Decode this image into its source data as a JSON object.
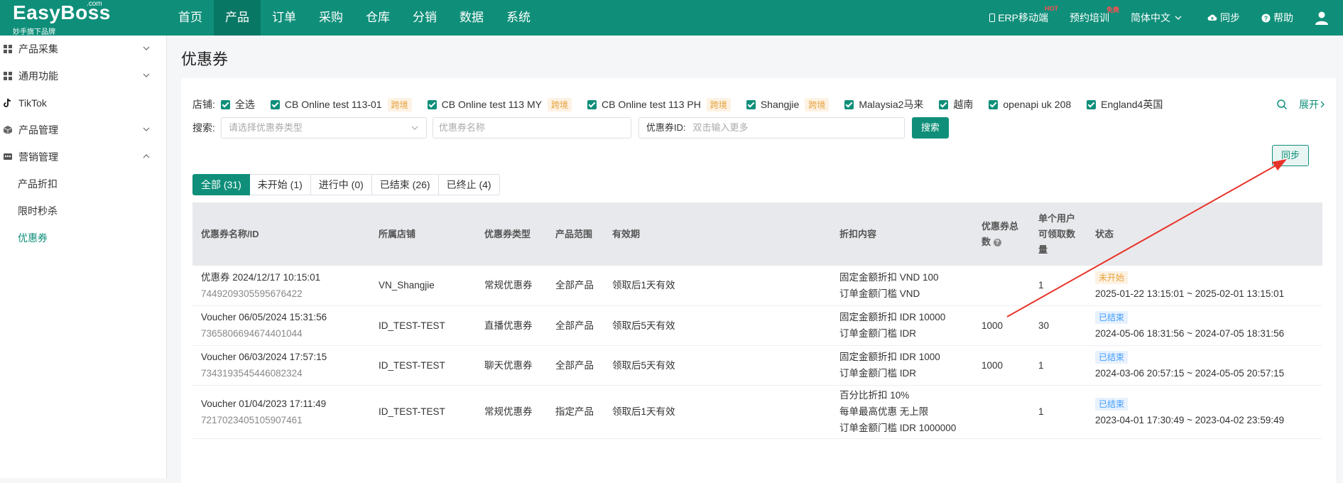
{
  "brand": {
    "name": "EasyBoss",
    "com": ".com",
    "slogan": "妙手旗下品牌"
  },
  "nav": [
    "首页",
    "产品",
    "订单",
    "采购",
    "仓库",
    "分销",
    "数据",
    "系统"
  ],
  "nav_active": 1,
  "top_right": {
    "erp": "ERP移动端",
    "erp_badge": "HOT",
    "training": "预约培训",
    "training_badge": "免费",
    "lang": "简体中文",
    "sync": "同步",
    "help": "帮助"
  },
  "sidebar": {
    "groups": [
      {
        "label": "产品采集",
        "expandable": true
      },
      {
        "label": "通用功能",
        "expandable": true
      },
      {
        "label": "TikTok",
        "expandable": false
      },
      {
        "label": "产品管理",
        "expandable": true
      },
      {
        "label": "营销管理",
        "expandable": true,
        "open": true
      }
    ],
    "subitems": [
      "产品折扣",
      "限时秒杀",
      "优惠券"
    ],
    "active_sub": 2
  },
  "page_title": "优惠券",
  "filters": {
    "store_label": "店铺:",
    "stores": [
      {
        "name": "全选",
        "tag": ""
      },
      {
        "name": "CB Online test 113-01",
        "tag": "跨境"
      },
      {
        "name": "CB Online test 113 MY",
        "tag": "跨境"
      },
      {
        "name": "CB Online test 113 PH",
        "tag": "跨境"
      },
      {
        "name": "Shangjie",
        "tag": "跨境"
      },
      {
        "name": "Malaysia2马来",
        "tag": ""
      },
      {
        "name": "越南",
        "tag": ""
      },
      {
        "name": "openapi uk 208",
        "tag": ""
      },
      {
        "name": "England4英国",
        "tag": ""
      }
    ],
    "expand_label": "展开",
    "search_label": "搜索:",
    "type_placeholder": "请选择优惠券类型",
    "name_placeholder": "优惠券名称",
    "id_label": "优惠券ID:",
    "id_placeholder": "双击输入更多",
    "search_button": "搜索"
  },
  "sync_button": "同步",
  "tabs": [
    "全部 (31)",
    "未开始 (1)",
    "进行中 (0)",
    "已结束 (26)",
    "已终止 (4)"
  ],
  "tab_active": 0,
  "table": {
    "headers": [
      "优惠券名称/ID",
      "所属店铺",
      "优惠券类型",
      "产品范围",
      "有效期",
      "折扣内容",
      "优惠券总数",
      "单个用户可领取数量",
      "状态"
    ],
    "rows": [
      {
        "name": "优惠券 2024/12/17 10:15:01",
        "id": "7449209305595676422",
        "store": "VN_Shangjie",
        "type": "常规优惠券",
        "scope": "全部产品",
        "validity": "领取后1天有效",
        "discount": [
          "固定金额折扣 VND 100",
          "订单金额门槛 VND"
        ],
        "total": "",
        "per_user": "1",
        "status": "未开始",
        "status_kind": "pending",
        "period": "2025-01-22 13:15:01 ~ 2025-02-01 13:15:01"
      },
      {
        "name": "Voucher 06/05/2024 15:31:56",
        "id": "7365806694674401044",
        "store": "ID_TEST-TEST",
        "type": "直播优惠券",
        "scope": "全部产品",
        "validity": "领取后5天有效",
        "discount": [
          "固定金额折扣 IDR 10000",
          "订单金额门槛 IDR"
        ],
        "total": "1000",
        "per_user": "30",
        "status": "已结束",
        "status_kind": "ended",
        "period": "2024-05-06 18:31:56 ~ 2024-07-05 18:31:56"
      },
      {
        "name": "Voucher 06/03/2024 17:57:15",
        "id": "7343193545446082324",
        "store": "ID_TEST-TEST",
        "type": "聊天优惠券",
        "scope": "全部产品",
        "validity": "领取后5天有效",
        "discount": [
          "固定金额折扣 IDR 1000",
          "订单金额门槛 IDR"
        ],
        "total": "1000",
        "per_user": "1",
        "status": "已结束",
        "status_kind": "ended",
        "period": "2024-03-06 20:57:15 ~ 2024-05-05 20:57:15"
      },
      {
        "name": "Voucher 01/04/2023 17:11:49",
        "id": "7217023405105907461",
        "store": "ID_TEST-TEST",
        "type": "常规优惠券",
        "scope": "指定产品",
        "validity": "领取后1天有效",
        "discount": [
          "百分比折扣 10%",
          "每单最高优惠 无上限",
          "订单金额门槛 IDR 1000000"
        ],
        "total": "",
        "per_user": "1",
        "status": "已结束",
        "status_kind": "ended",
        "period": "2023-04-01 17:30:49 ~ 2023-04-02 23:59:49"
      }
    ]
  },
  "colors": {
    "brand": "#0f8f7a",
    "arrow": "#e8332a"
  }
}
